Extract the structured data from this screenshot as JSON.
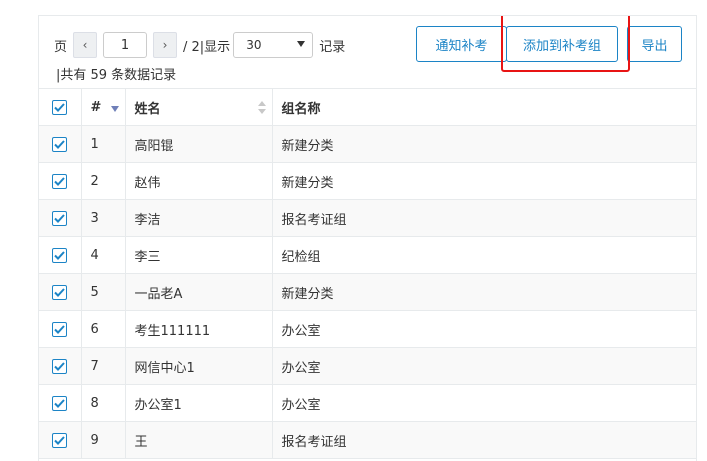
{
  "pager": {
    "page_label": "页",
    "prev_icon": "‹",
    "current_page": "1",
    "next_icon": "›",
    "total_pages_text": "/ 2|显示",
    "page_size": "30",
    "records_label": "记录",
    "total_text": "|共有 59 条数据记录"
  },
  "actions": {
    "notify_label": "通知补考",
    "add_label": "添加到补考组",
    "export_label": "导出"
  },
  "colors": {
    "accent": "#1c84c6",
    "highlight": "#e81414"
  },
  "table": {
    "headers": {
      "index": "#",
      "name": "姓名",
      "group": "组名称"
    },
    "rows": [
      {
        "index": "1",
        "name": "高阳锟",
        "group": "新建分类",
        "checked": true
      },
      {
        "index": "2",
        "name": "赵伟",
        "group": "新建分类",
        "checked": true
      },
      {
        "index": "3",
        "name": "李洁",
        "group": "报名考证组",
        "checked": true
      },
      {
        "index": "4",
        "name": "李三",
        "group": "纪检组",
        "checked": true
      },
      {
        "index": "5",
        "name": "一品老A",
        "group": "新建分类",
        "checked": true
      },
      {
        "index": "6",
        "name": "考生111111",
        "group": "办公室",
        "checked": true
      },
      {
        "index": "7",
        "name": "网信中心1",
        "group": "办公室",
        "checked": true
      },
      {
        "index": "8",
        "name": "办公室1",
        "group": "办公室",
        "checked": true
      },
      {
        "index": "9",
        "name": "王",
        "group": "报名考证组",
        "checked": true
      }
    ]
  }
}
